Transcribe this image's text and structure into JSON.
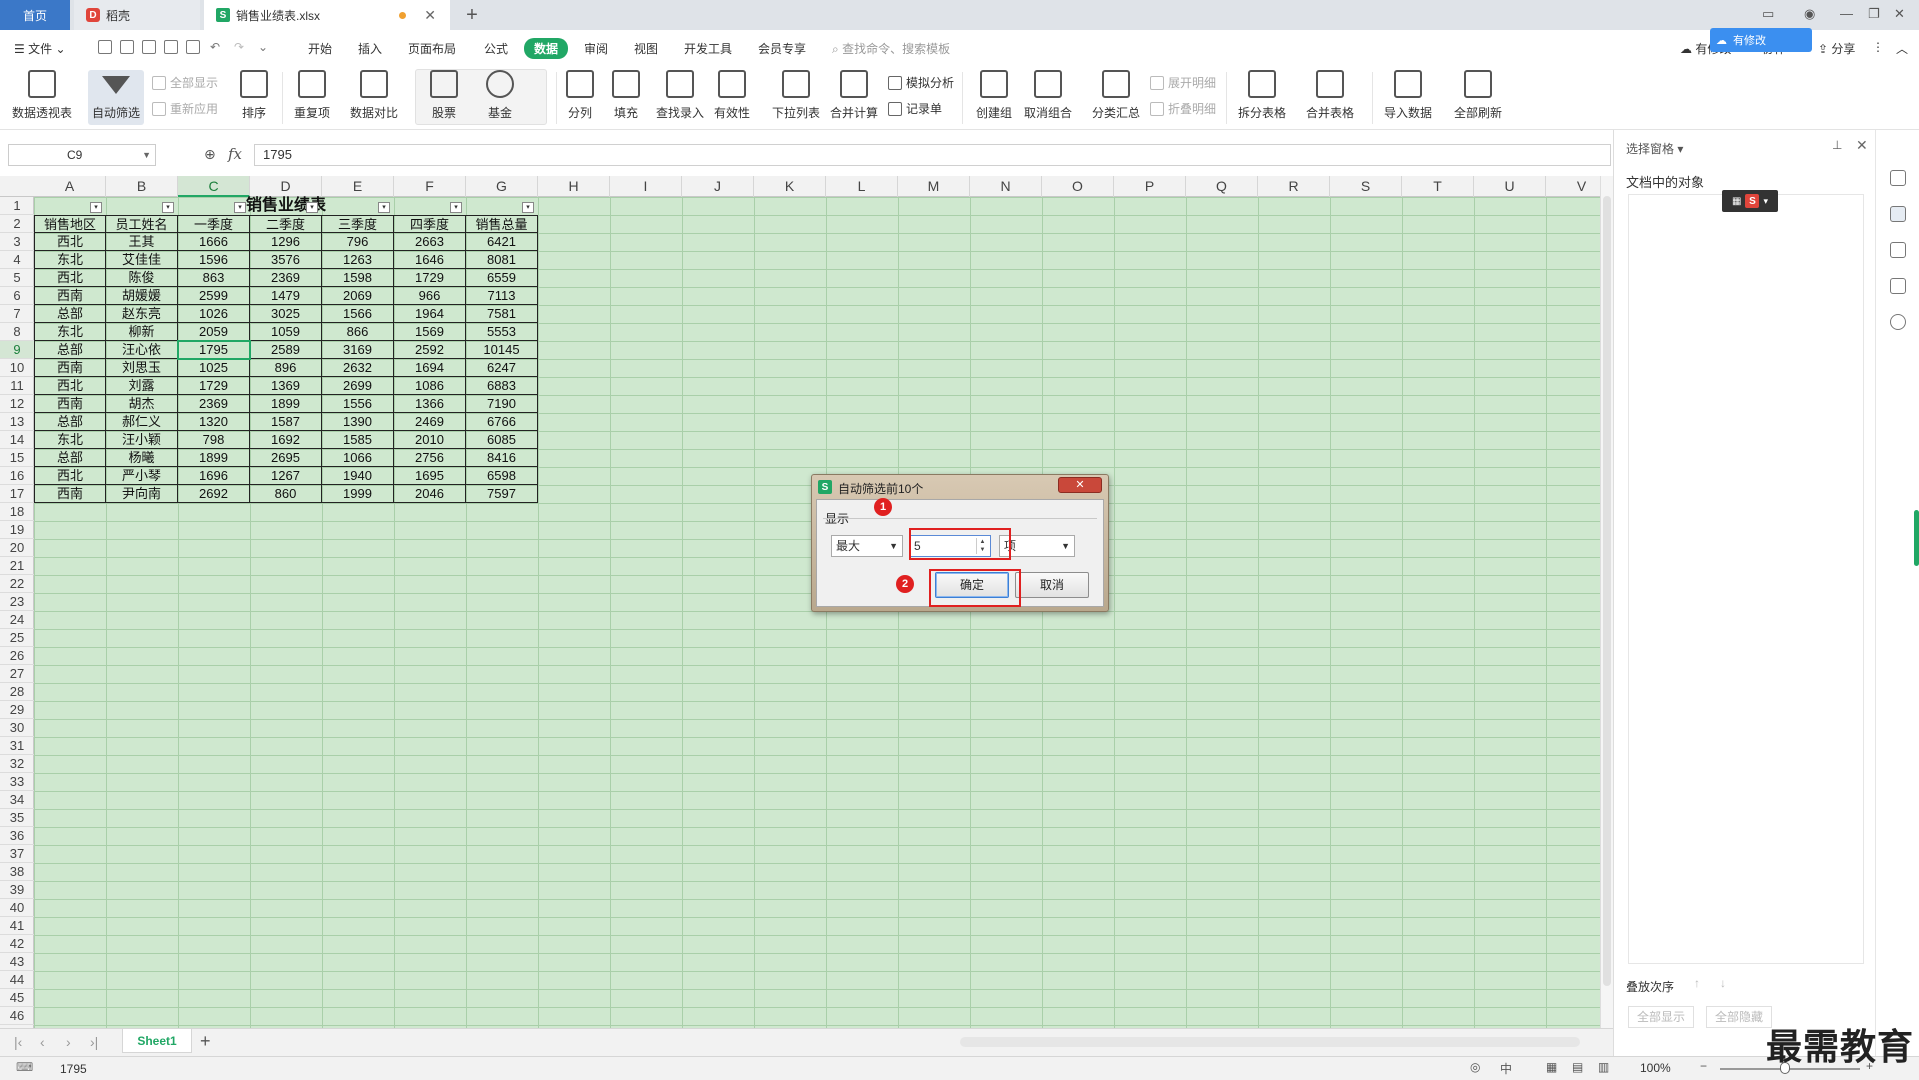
{
  "tabs": {
    "home": "首页",
    "daoke": "稻壳",
    "file": "销售业绩表.xlsx"
  },
  "menu": {
    "file": "文件",
    "items": [
      "开始",
      "插入",
      "页面布局",
      "公式",
      "数据",
      "审阅",
      "视图",
      "开发工具",
      "会员专享"
    ],
    "active": "数据",
    "search_placeholder": "查找命令、搜索模板",
    "sync": "有修改",
    "cooperate": "协作",
    "share": "分享",
    "cloud_badge": "有修改"
  },
  "ribbon": {
    "pivot": "数据透视表",
    "autofilter": "自动筛选",
    "show_all": "全部显示",
    "reapply": "重新应用",
    "sort": "排序",
    "duplicates": "重复项",
    "compare": "数据对比",
    "stock": "股票",
    "fund": "基金",
    "split": "分列",
    "fill": "填充",
    "lookup_input": "查找录入",
    "validity": "有效性",
    "dropdown_list": "下拉列表",
    "consolidate": "合并计算",
    "simulate": "模拟分析",
    "record": "记录单",
    "create_group": "创建组",
    "ungroup": "取消组合",
    "subtotal": "分类汇总",
    "expand_detail": "展开明细",
    "collapse_detail": "折叠明细",
    "split_table": "拆分表格",
    "merge_table": "合并表格",
    "import_data": "导入数据",
    "refresh_all": "全部刷新"
  },
  "formula_bar": {
    "cell_ref": "C9",
    "fx": "fx",
    "value": "1795"
  },
  "columns": [
    "A",
    "B",
    "C",
    "D",
    "E",
    "F",
    "G",
    "H",
    "I",
    "J",
    "K",
    "L",
    "M",
    "N",
    "O",
    "P",
    "Q",
    "R",
    "S",
    "T",
    "U",
    "V"
  ],
  "rows": [
    "1",
    "2",
    "3",
    "4",
    "5",
    "6",
    "7",
    "8",
    "9",
    "10",
    "11",
    "12",
    "13",
    "14",
    "15",
    "16",
    "17",
    "18",
    "19",
    "20",
    "21",
    "22",
    "23",
    "24",
    "25",
    "26",
    "27",
    "28",
    "29",
    "30",
    "31",
    "32",
    "33",
    "34",
    "35",
    "36",
    "37",
    "38",
    "39",
    "40",
    "41",
    "42",
    "43",
    "44",
    "45",
    "46"
  ],
  "sheet": {
    "title": "销售业绩表",
    "headers": [
      "销售地区",
      "员工姓名",
      "一季度",
      "二季度",
      "三季度",
      "四季度",
      "销售总量"
    ],
    "data": [
      [
        "西北",
        "王其",
        "1666",
        "1296",
        "796",
        "2663",
        "6421"
      ],
      [
        "东北",
        "艾佳佳",
        "1596",
        "3576",
        "1263",
        "1646",
        "8081"
      ],
      [
        "西北",
        "陈俊",
        "863",
        "2369",
        "1598",
        "1729",
        "6559"
      ],
      [
        "西南",
        "胡媛媛",
        "2599",
        "1479",
        "2069",
        "966",
        "7113"
      ],
      [
        "总部",
        "赵东亮",
        "1026",
        "3025",
        "1566",
        "1964",
        "7581"
      ],
      [
        "东北",
        "柳新",
        "2059",
        "1059",
        "866",
        "1569",
        "5553"
      ],
      [
        "总部",
        "汪心依",
        "1795",
        "2589",
        "3169",
        "2592",
        "10145"
      ],
      [
        "西南",
        "刘思玉",
        "1025",
        "896",
        "2632",
        "1694",
        "6247"
      ],
      [
        "西北",
        "刘露",
        "1729",
        "1369",
        "2699",
        "1086",
        "6883"
      ],
      [
        "西南",
        "胡杰",
        "2369",
        "1899",
        "1556",
        "1366",
        "7190"
      ],
      [
        "总部",
        "郝仁义",
        "1320",
        "1587",
        "1390",
        "2469",
        "6766"
      ],
      [
        "东北",
        "汪小颖",
        "798",
        "1692",
        "1585",
        "2010",
        "6085"
      ],
      [
        "总部",
        "杨曦",
        "1899",
        "2695",
        "1066",
        "2756",
        "8416"
      ],
      [
        "西北",
        "严小琴",
        "1696",
        "1267",
        "1940",
        "1695",
        "6598"
      ],
      [
        "西南",
        "尹向南",
        "2692",
        "860",
        "1999",
        "2046",
        "7597"
      ]
    ]
  },
  "sheet_tab": "Sheet1",
  "status": {
    "value": "1795",
    "zoom": "100%"
  },
  "pane": {
    "title": "选择窗格",
    "objects_label": "文档中的对象",
    "order_label": "叠放次序",
    "show_all": "全部显示",
    "hide_all": "全部隐藏"
  },
  "dialog": {
    "title": "自动筛选前10个",
    "group_label": "显示",
    "direction": "最大",
    "count": "5",
    "unit": "项",
    "ok": "确定",
    "cancel": "取消",
    "marker1": "1",
    "marker2": "2"
  },
  "watermark": "最需教育"
}
